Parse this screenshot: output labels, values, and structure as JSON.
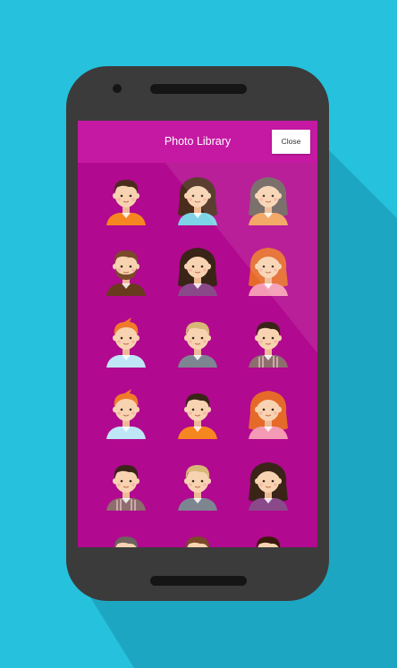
{
  "header": {
    "title": "Photo Library",
    "close_label": "Close"
  },
  "colors": {
    "background": "#26c1dc",
    "phone_body": "#3b3b3b",
    "screen_bg": "#b1098f",
    "header_bg": "#c519a3"
  },
  "avatars": [
    {
      "name": "avatar-boy-brown-hair-orange-shirt"
    },
    {
      "name": "avatar-girl-dark-hair-blue-shirt"
    },
    {
      "name": "avatar-girl-gray-hair-orange-shirt"
    },
    {
      "name": "avatar-man-beard-brown-jacket"
    },
    {
      "name": "avatar-girl-dark-hair-purple-shirt"
    },
    {
      "name": "avatar-girl-red-hair-pink-shirt"
    },
    {
      "name": "avatar-boy-orange-hair-blue-shirt"
    },
    {
      "name": "avatar-boy-blond-hair-gray-shirt"
    },
    {
      "name": "avatar-boy-dark-hair-striped-shirt"
    },
    {
      "name": "avatar-boy-orange-hair-blue-shirt-2"
    },
    {
      "name": "avatar-boy-dark-hair-orange-shirt"
    },
    {
      "name": "avatar-girl-red-hair-pink-shirt-2"
    },
    {
      "name": "avatar-boy-dark-hair-striped-shirt-2"
    },
    {
      "name": "avatar-boy-blond-hair-gray-shirt-2"
    },
    {
      "name": "avatar-girl-dark-hair-purple-shirt-2"
    },
    {
      "name": "avatar-partial-1"
    },
    {
      "name": "avatar-partial-2"
    },
    {
      "name": "avatar-partial-3"
    }
  ]
}
